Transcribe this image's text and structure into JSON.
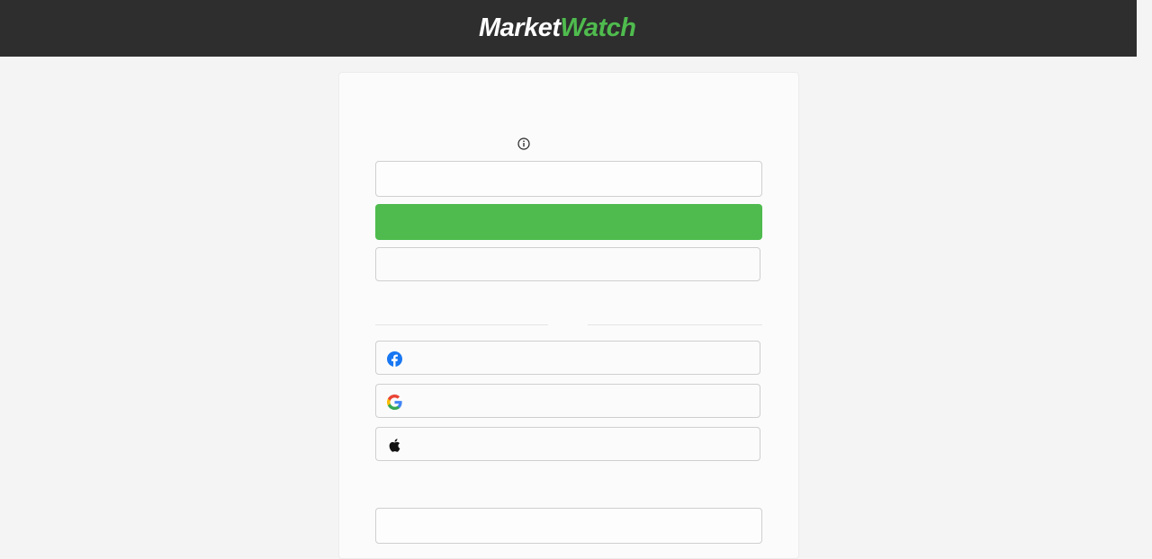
{
  "header": {
    "logo_part1": "Market",
    "logo_part2": "Watch"
  },
  "form": {
    "email_label": "",
    "email_placeholder": "",
    "continue_label": "",
    "secondary_label": "",
    "divider_text": "",
    "social": [
      {
        "icon": "facebook-icon",
        "label": ""
      },
      {
        "icon": "google-icon",
        "label": ""
      },
      {
        "icon": "apple-icon",
        "label": ""
      }
    ],
    "bottom_field_placeholder": ""
  },
  "colors": {
    "header_bg": "#2e2e2e",
    "accent_green": "#4fbb4e",
    "page_bg": "#f4f4f4",
    "facebook_blue": "#1877f2"
  }
}
